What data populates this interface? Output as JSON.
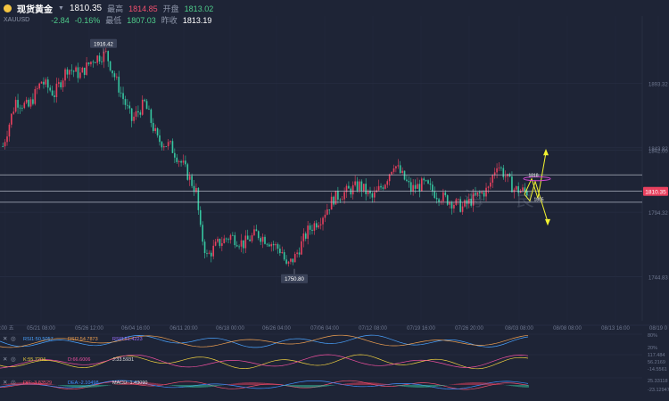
{
  "header": {
    "symbol": "现货黄金",
    "dropdown_icon": "caret-down-icon",
    "price": "1810.35",
    "change": "-2.84",
    "change_pct": "-0.16%",
    "code": "XAUUSD",
    "high_label": "最高",
    "high": "1814.85",
    "open_label": "开盘",
    "open": "1813.02",
    "low_label": "最低",
    "low": "1807.03",
    "prev_label": "昨收",
    "prev": "1813.19"
  },
  "watermark": "海 良",
  "colors": {
    "background": "#1e2436",
    "up": "#e8405e",
    "down": "#36c6a0",
    "current_price_tag": "#e8405e",
    "annotation_arrow": "#f2f230",
    "annotation_ellipse": "#d44ad4"
  },
  "chart_data": {
    "type": "candlestick",
    "price_axis": {
      "ticks": [
        "1842.00",
        "1893.32",
        "1843.82",
        "1794.32",
        "1744.83"
      ],
      "ylim": [
        1728,
        1945
      ]
    },
    "time_axis": {
      "ticks": [
        "0:00 五",
        "05/21 08:00",
        "05/26 12:00",
        "06/04 16:00",
        "06/11 20:00",
        "06/18 00:00",
        "06/26 04:00",
        "07/06 04:00",
        "07/12 08:00",
        "07/19 16:00",
        "07/26 20:00",
        "08/03 08:00",
        "08/08 08:00",
        "08/13 16:00",
        "08/19 0"
      ]
    },
    "annotations": {
      "high_label": "1916.42",
      "low_label": "1750.80",
      "current_price": "1810.35",
      "level_1": "1818",
      "level_2": "1805"
    },
    "candle_path": [
      [
        0,
        1845
      ],
      [
        6,
        1880
      ],
      [
        12,
        1875
      ],
      [
        18,
        1895
      ],
      [
        24,
        1885
      ],
      [
        30,
        1905
      ],
      [
        36,
        1900
      ],
      [
        42,
        1912
      ],
      [
        48,
        1916
      ],
      [
        54,
        1890
      ],
      [
        60,
        1865
      ],
      [
        66,
        1878
      ],
      [
        72,
        1850
      ],
      [
        78,
        1845
      ],
      [
        84,
        1830
      ],
      [
        90,
        1810
      ],
      [
        92,
        1780
      ],
      [
        95,
        1760
      ],
      [
        100,
        1770
      ],
      [
        106,
        1776
      ],
      [
        112,
        1770
      ],
      [
        118,
        1778
      ],
      [
        124,
        1772
      ],
      [
        130,
        1764
      ],
      [
        132,
        1752
      ],
      [
        136,
        1760
      ],
      [
        142,
        1780
      ],
      [
        148,
        1790
      ],
      [
        154,
        1805
      ],
      [
        160,
        1810
      ],
      [
        166,
        1815
      ],
      [
        172,
        1805
      ],
      [
        178,
        1818
      ],
      [
        182,
        1832
      ],
      [
        186,
        1822
      ],
      [
        190,
        1812
      ],
      [
        196,
        1816
      ],
      [
        202,
        1808
      ],
      [
        208,
        1803
      ],
      [
        214,
        1798
      ],
      [
        220,
        1806
      ],
      [
        226,
        1812
      ],
      [
        230,
        1832
      ],
      [
        234,
        1822
      ],
      [
        238,
        1812
      ],
      [
        244,
        1810
      ]
    ],
    "indicators": {
      "rsi": {
        "labels": [
          "RSI1:50.5057",
          "RSI2:54.7873",
          "RSI3:51.4223"
        ],
        "axis": [
          "80%",
          "20%"
        ]
      },
      "kdj": {
        "labels": [
          "K:55.7204",
          "D:66.6006",
          "J:33.5931"
        ],
        "axis": [
          "117.484",
          "56.2169",
          "-14.5561"
        ]
      },
      "macd": {
        "labels": [
          "DIF:-3.83529",
          "DEA:-2.10498",
          "MACD:-1.43090"
        ],
        "axis": [
          "25.33118",
          "-23.12947"
        ]
      }
    }
  }
}
